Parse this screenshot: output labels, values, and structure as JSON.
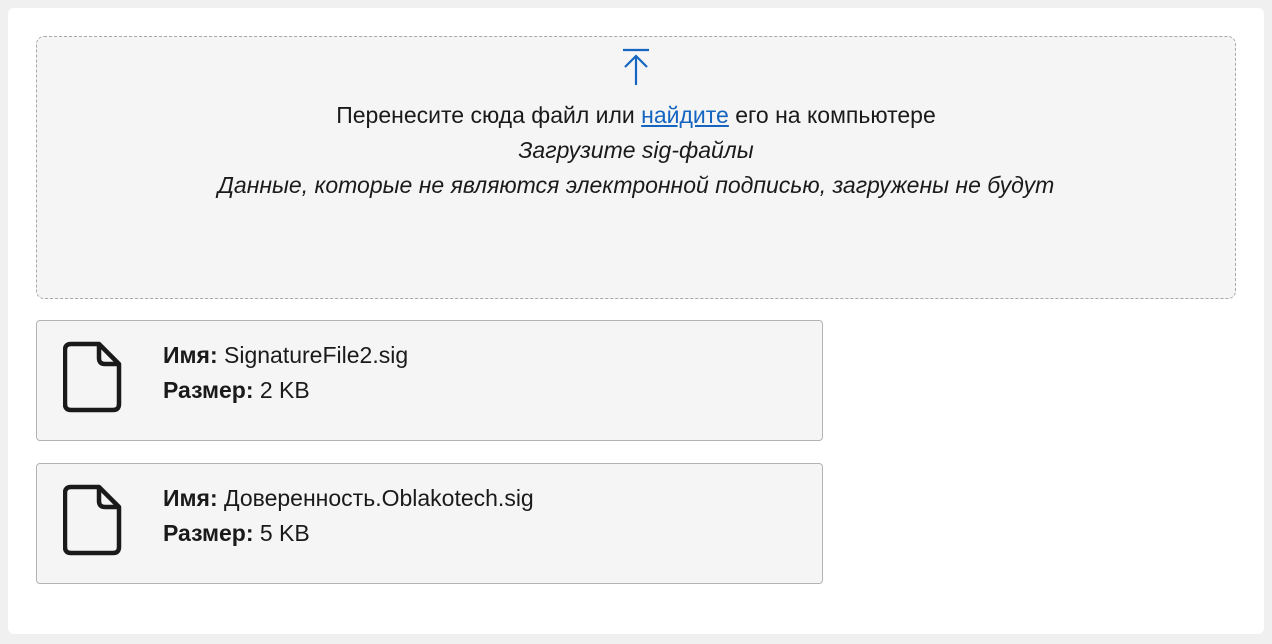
{
  "dropzone": {
    "prompt_before": "Перенесите сюда файл или ",
    "browse_link": "найдите",
    "prompt_after": " его на компьютере",
    "hint_format": "Загрузите sig-файлы",
    "hint_warning": "Данные, которые не являются электронной подписью, загружены не будут",
    "icon": "upload-icon",
    "accent_color": "#1565c0"
  },
  "files": [
    {
      "name_label": "Имя:",
      "name": "SignatureFile2.sig",
      "size_label": "Размер:",
      "size": "2 KB",
      "icon": "file-icon"
    },
    {
      "name_label": "Имя:",
      "name": "Доверенность.Oblakotech.sig",
      "size_label": "Размер:",
      "size": "5 KB",
      "icon": "file-icon"
    }
  ]
}
